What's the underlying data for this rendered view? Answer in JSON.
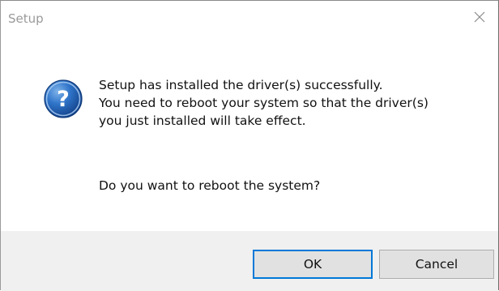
{
  "dialog": {
    "title": "Setup",
    "message_lines": [
      "Setup has installed the driver(s) successfully.",
      "You need to reboot your system so that the driver(s)",
      "you just installed will take effect."
    ],
    "question": "Do you want to reboot the system?",
    "icon": "question-icon",
    "buttons": {
      "ok_label": "OK",
      "cancel_label": "Cancel"
    },
    "close_icon": "close-icon"
  },
  "colors": {
    "title_text": "#9a9a9a",
    "footer_bg": "#f0f0f0",
    "button_bg": "#e1e1e1",
    "default_button_border": "#0078d7",
    "icon_blue": "#1e63b5"
  }
}
